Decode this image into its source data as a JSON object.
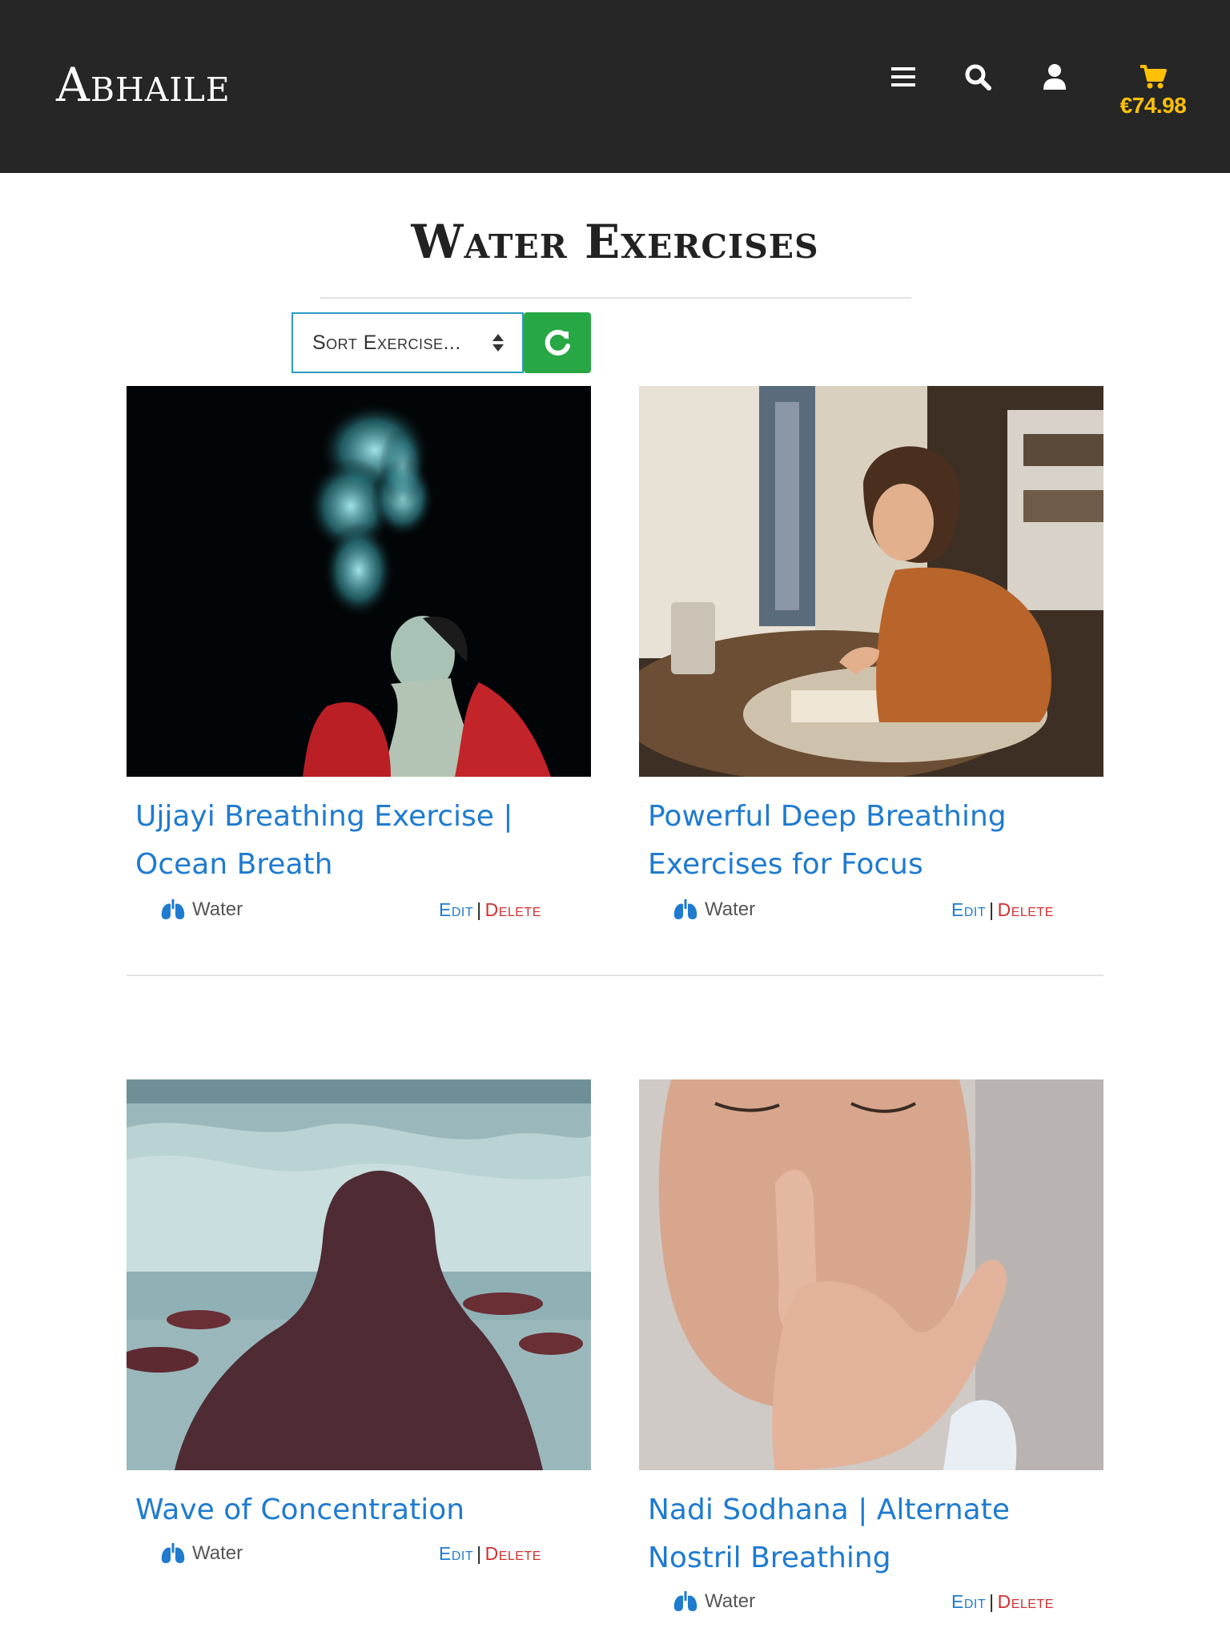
{
  "header": {
    "brand": "Abhaile",
    "cart_total": "€74.98",
    "icons": [
      "menu-icon",
      "search-icon",
      "user-icon",
      "cart-icon"
    ]
  },
  "page": {
    "title": "Water Exercises"
  },
  "controls": {
    "sort_label": "Sort Exercise...",
    "reset_icon": "refresh-icon"
  },
  "colors": {
    "navbar": "#262626",
    "cart_accent": "#ffc107",
    "link_blue": "#1f7bd0",
    "delete_red": "#d13030",
    "reset_green": "#28a745"
  },
  "exercises": [
    {
      "title": "Ujjayi Breathing Exercise | Ocean Breath",
      "category": "Water",
      "category_icon": "lungs-icon",
      "edit": "Edit",
      "separator": "|",
      "delete": "Delete"
    },
    {
      "title": "Powerful Deep Breathing Exercises for Focus",
      "category": "Water",
      "category_icon": "lungs-icon",
      "edit": "Edit",
      "separator": "|",
      "delete": "Delete"
    },
    {
      "title": "Wave of Concentration",
      "category": "Water",
      "category_icon": "lungs-icon",
      "edit": "Edit",
      "separator": "|",
      "delete": "Delete"
    },
    {
      "title": "Nadi Sodhana | Alternate Nostril Breathing",
      "category": "Water",
      "category_icon": "lungs-icon",
      "edit": "Edit",
      "separator": "|",
      "delete": "Delete"
    }
  ]
}
